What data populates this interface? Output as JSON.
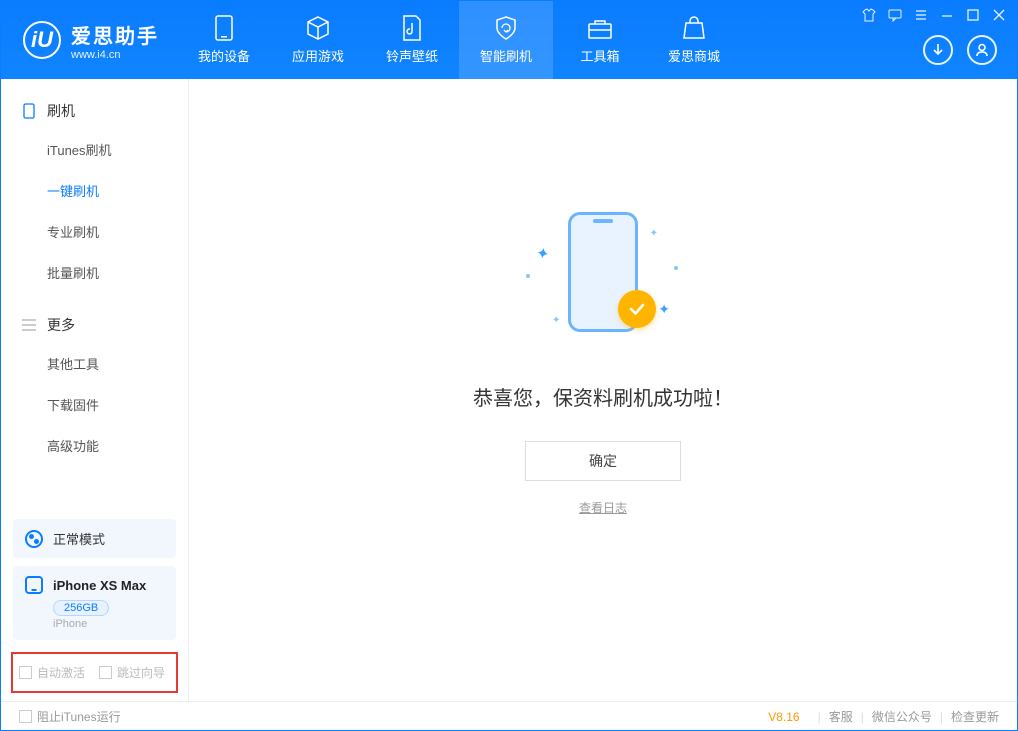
{
  "app": {
    "title": "爱思助手",
    "url": "www.i4.cn"
  },
  "tabs": [
    {
      "label": "我的设备"
    },
    {
      "label": "应用游戏"
    },
    {
      "label": "铃声壁纸"
    },
    {
      "label": "智能刷机"
    },
    {
      "label": "工具箱"
    },
    {
      "label": "爱思商城"
    }
  ],
  "sidebar": {
    "flash_header": "刷机",
    "flash_items": [
      "iTunes刷机",
      "一键刷机",
      "专业刷机",
      "批量刷机"
    ],
    "more_header": "更多",
    "more_items": [
      "其他工具",
      "下载固件",
      "高级功能"
    ]
  },
  "mode": {
    "label": "正常模式"
  },
  "device": {
    "name": "iPhone XS Max",
    "storage": "256GB",
    "type": "iPhone"
  },
  "options": {
    "auto_activate": "自动激活",
    "skip_guide": "跳过向导"
  },
  "main": {
    "success": "恭喜您，保资料刷机成功啦！",
    "ok": "确定",
    "view_log": "查看日志"
  },
  "footer": {
    "block_itunes": "阻止iTunes运行",
    "version": "V8.16",
    "support": "客服",
    "wechat": "微信公众号",
    "update": "检查更新"
  }
}
